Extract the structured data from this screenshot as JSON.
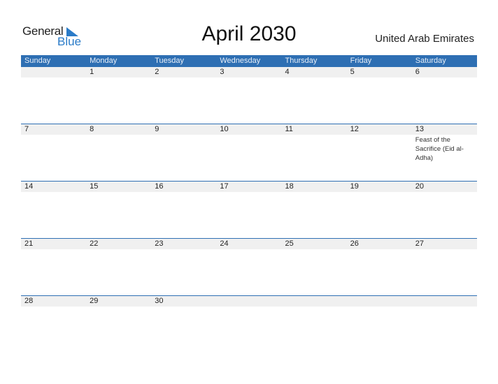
{
  "logo": {
    "word1": "General",
    "word2": "Blue",
    "icon": "triangle-flag-icon"
  },
  "title": "April 2030",
  "country": "United Arab Emirates",
  "colors": {
    "header_bg": "#2e6fb3",
    "accent": "#2a7bc8",
    "row_bg": "#f0f0f0"
  },
  "weekdays": [
    "Sunday",
    "Monday",
    "Tuesday",
    "Wednesday",
    "Thursday",
    "Friday",
    "Saturday"
  ],
  "weeks": [
    [
      {
        "day": ""
      },
      {
        "day": "1"
      },
      {
        "day": "2"
      },
      {
        "day": "3"
      },
      {
        "day": "4"
      },
      {
        "day": "5"
      },
      {
        "day": "6"
      }
    ],
    [
      {
        "day": "7"
      },
      {
        "day": "8"
      },
      {
        "day": "9"
      },
      {
        "day": "10"
      },
      {
        "day": "11"
      },
      {
        "day": "12"
      },
      {
        "day": "13",
        "event": "Feast of the Sacrifice (Eid al-Adha)"
      }
    ],
    [
      {
        "day": "14"
      },
      {
        "day": "15"
      },
      {
        "day": "16"
      },
      {
        "day": "17"
      },
      {
        "day": "18"
      },
      {
        "day": "19"
      },
      {
        "day": "20"
      }
    ],
    [
      {
        "day": "21"
      },
      {
        "day": "22"
      },
      {
        "day": "23"
      },
      {
        "day": "24"
      },
      {
        "day": "25"
      },
      {
        "day": "26"
      },
      {
        "day": "27"
      }
    ],
    [
      {
        "day": "28"
      },
      {
        "day": "29"
      },
      {
        "day": "30"
      },
      {
        "day": ""
      },
      {
        "day": ""
      },
      {
        "day": ""
      },
      {
        "day": ""
      }
    ]
  ]
}
